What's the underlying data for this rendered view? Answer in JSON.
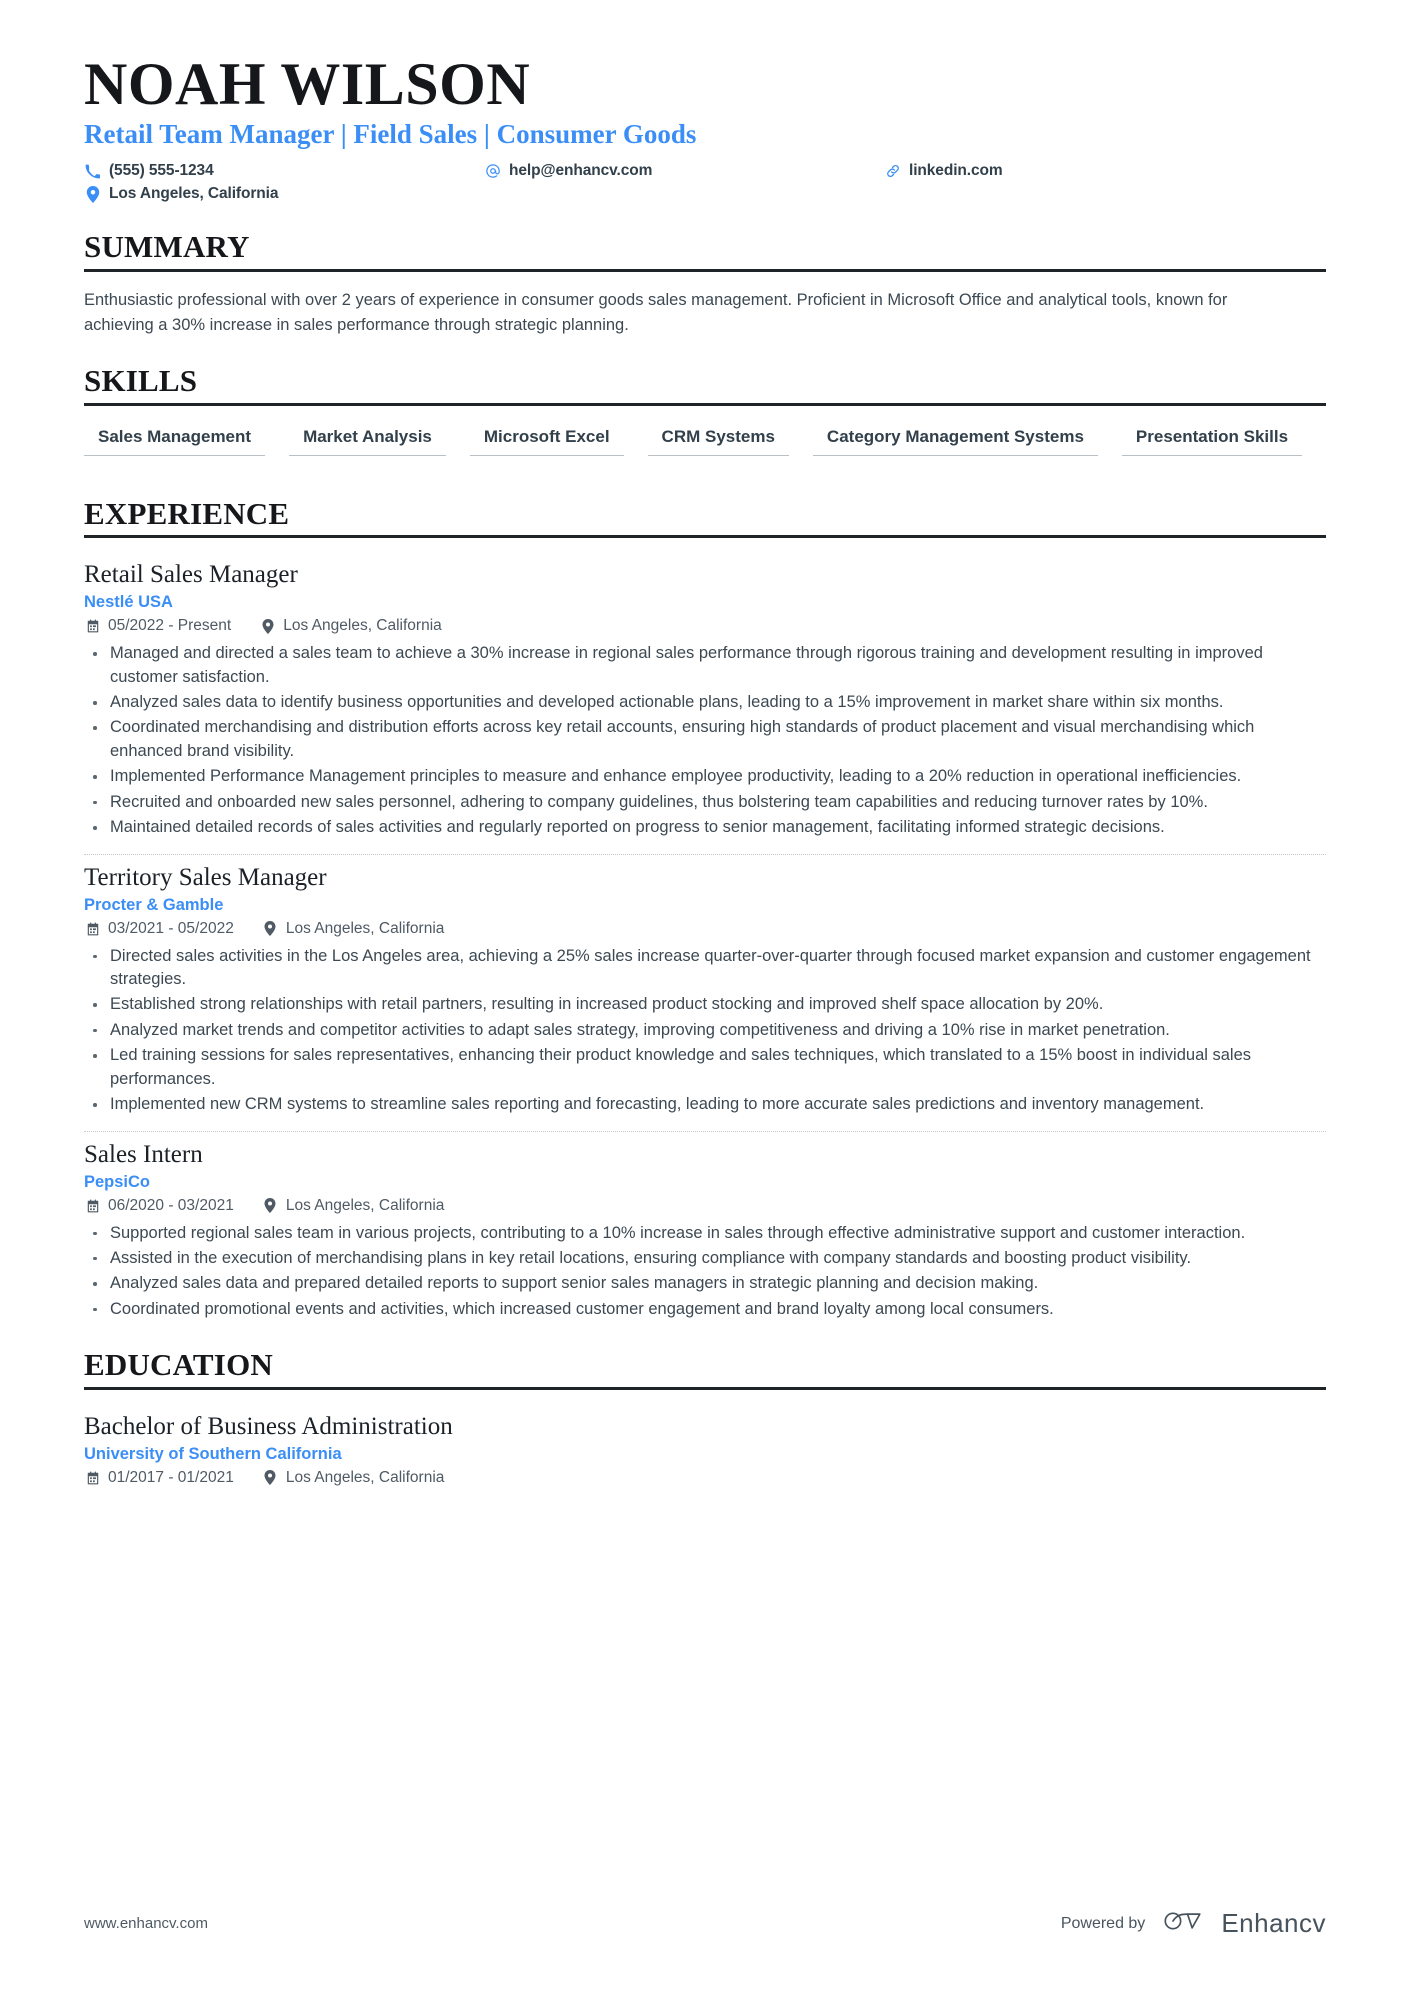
{
  "colors": {
    "accent": "#3a8ef6",
    "text": "#3c4852",
    "heading": "#15171a",
    "rule": "#1f2429"
  },
  "header": {
    "name": "NOAH WILSON",
    "headline": "Retail Team Manager | Field Sales | Consumer Goods",
    "contacts": {
      "phone": "(555) 555-1234",
      "email": "help@enhancv.com",
      "website": "linkedin.com",
      "location": "Los Angeles, California"
    }
  },
  "sections": {
    "summary": {
      "title": "SUMMARY",
      "text": "Enthusiastic professional with over 2 years of experience in consumer goods sales management. Proficient in Microsoft Office and analytical tools, known for achieving a 30% increase in sales performance through strategic planning."
    },
    "skills": {
      "title": "SKILLS",
      "items": [
        "Sales Management",
        "Market Analysis",
        "Microsoft Excel",
        "CRM Systems",
        "Category Management Systems",
        "Presentation Skills"
      ]
    },
    "experience": {
      "title": "EXPERIENCE",
      "entries": [
        {
          "job_title": "Retail Sales Manager",
          "company": "Nestlé USA",
          "dates": "05/2022 - Present",
          "location": "Los Angeles, California",
          "bullets": [
            "Managed and directed a sales team to achieve a 30% increase in regional sales performance through rigorous training and development resulting in improved customer satisfaction.",
            "Analyzed sales data to identify business opportunities and developed actionable plans, leading to a 15% improvement in market share within six months.",
            "Coordinated merchandising and distribution efforts across key retail accounts, ensuring high standards of product placement and visual merchandising which enhanced brand visibility.",
            "Implemented Performance Management principles to measure and enhance employee productivity, leading to a 20% reduction in operational inefficiencies.",
            "Recruited and onboarded new sales personnel, adhering to company guidelines, thus bolstering team capabilities and reducing turnover rates by 10%.",
            "Maintained detailed records of sales activities and regularly reported on progress to senior management, facilitating informed strategic decisions."
          ]
        },
        {
          "job_title": "Territory Sales Manager",
          "company": "Procter & Gamble",
          "dates": "03/2021 - 05/2022",
          "location": "Los Angeles, California",
          "bullets": [
            "Directed sales activities in the Los Angeles area, achieving a 25% sales increase quarter-over-quarter through focused market expansion and customer engagement strategies.",
            "Established strong relationships with retail partners, resulting in increased product stocking and improved shelf space allocation by 20%.",
            "Analyzed market trends and competitor activities to adapt sales strategy, improving competitiveness and driving a 10% rise in market penetration.",
            "Led training sessions for sales representatives, enhancing their product knowledge and sales techniques, which translated to a 15% boost in individual sales performances.",
            "Implemented new CRM systems to streamline sales reporting and forecasting, leading to more accurate sales predictions and inventory management."
          ]
        },
        {
          "job_title": "Sales Intern",
          "company": "PepsiCo",
          "dates": "06/2020 - 03/2021",
          "location": "Los Angeles, California",
          "bullets": [
            "Supported regional sales team in various projects, contributing to a 10% increase in sales through effective administrative support and customer interaction.",
            "Assisted in the execution of merchandising plans in key retail locations, ensuring compliance with company standards and boosting product visibility.",
            "Analyzed sales data and prepared detailed reports to support senior sales managers in strategic planning and decision making.",
            "Coordinated promotional events and activities, which increased customer engagement and brand loyalty among local consumers."
          ]
        }
      ]
    },
    "education": {
      "title": "EDUCATION",
      "entries": [
        {
          "degree": "Bachelor of Business Administration",
          "school": "University of Southern California",
          "dates": "01/2017 - 01/2021",
          "location": "Los Angeles, California"
        }
      ]
    }
  },
  "footer": {
    "url": "www.enhancv.com",
    "powered_label": "Powered by",
    "brand_name": "Enhancv"
  }
}
